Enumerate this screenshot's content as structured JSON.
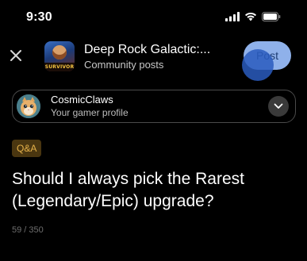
{
  "status_bar": {
    "time": "9:30",
    "icons": [
      "signal-icon",
      "wifi-icon",
      "battery-icon"
    ]
  },
  "header": {
    "close_icon": "close-icon",
    "game_title": "Deep Rock Galactic:...",
    "subtitle": "Community posts",
    "thumbnail_text": "SURVIVOR",
    "post_label": "Post"
  },
  "profile": {
    "name": "CosmicClaws",
    "subtitle": "Your gamer profile",
    "expand_icon": "chevron-down-icon"
  },
  "tag": {
    "label": "Q&A"
  },
  "question": {
    "text": "Should I always pick the Rarest (Legendary/Epic) upgrade?",
    "char_count": "59 / 350"
  },
  "colors": {
    "background": "#000000",
    "post_button": "#8fb1ea",
    "touch_indicator": "#2a5cbe",
    "tag_background": "#4a3610",
    "tag_text": "#e6b24a"
  }
}
